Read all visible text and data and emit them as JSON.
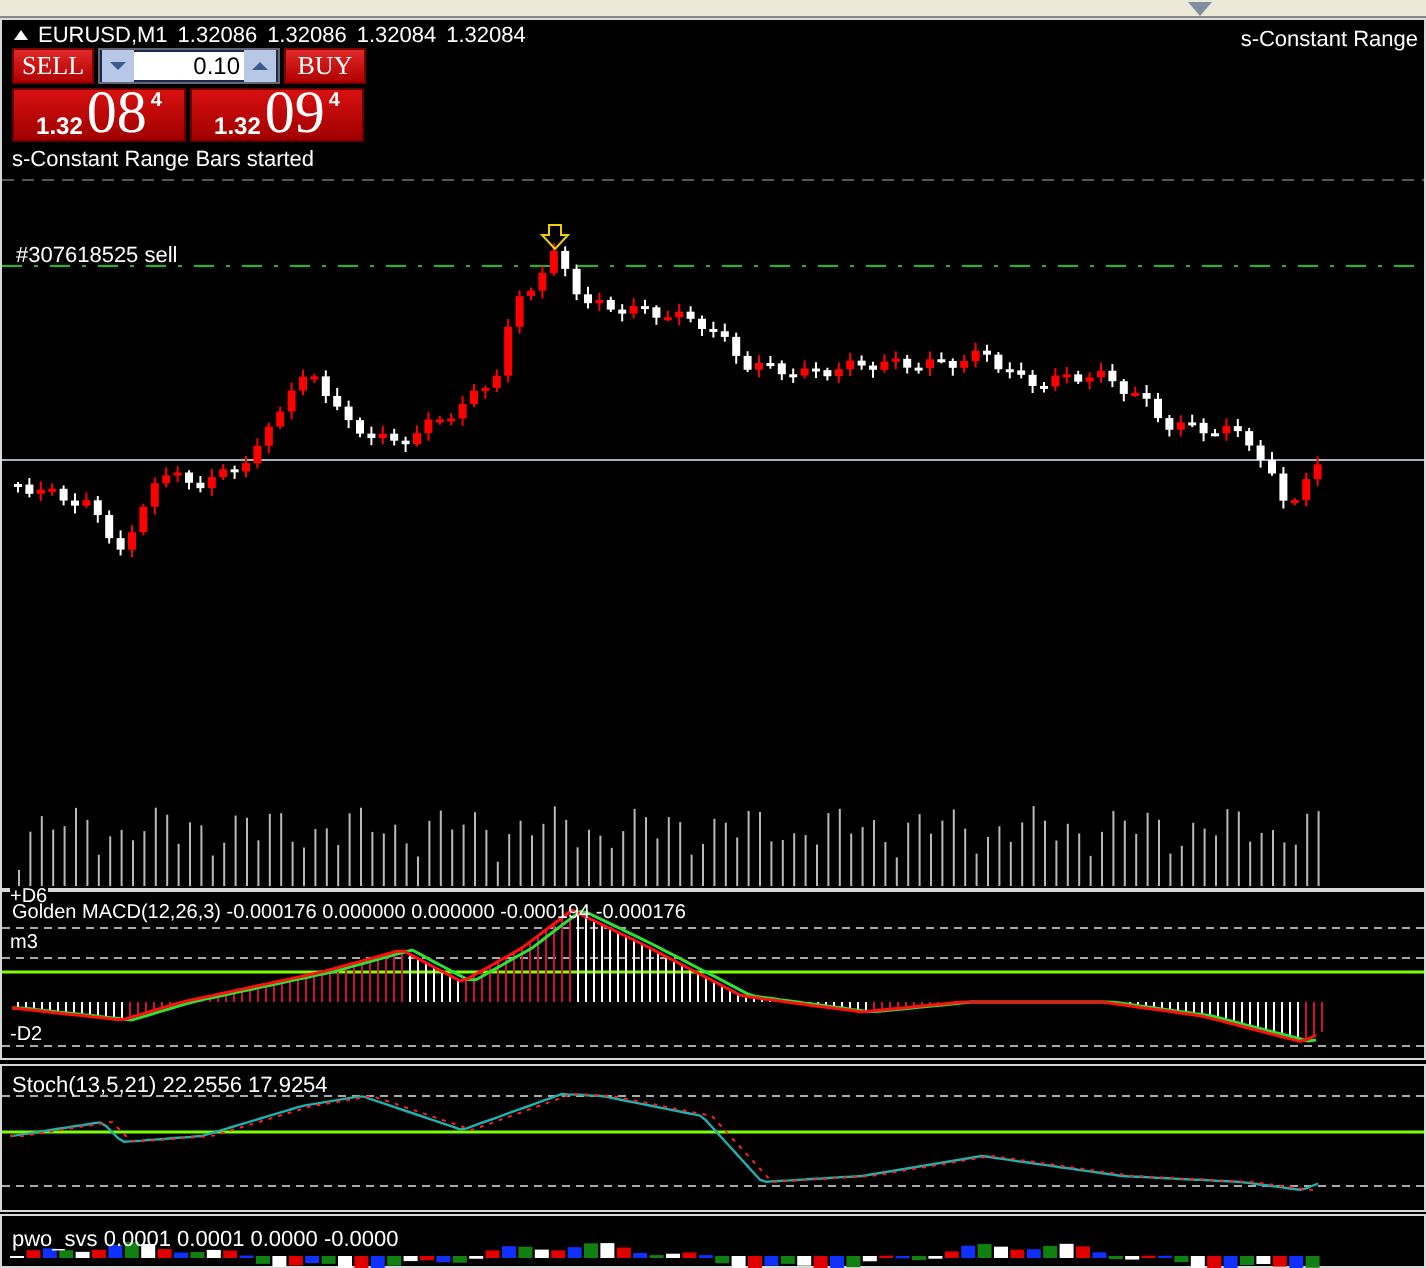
{
  "chart": {
    "symbol": "EURUSD,M1",
    "prices": [
      "1.32086",
      "1.32086",
      "1.32084",
      "1.32084"
    ],
    "indicator_label": "s-Constant Range",
    "status": "s-Constant Range Bars started",
    "order_label": "#307618525 sell"
  },
  "trade_panel": {
    "sell_button": "SELL",
    "buy_button": "BUY",
    "lot": "0.10",
    "sell_price": {
      "prefix": "1.32",
      "digits": "08",
      "last": "4"
    },
    "buy_price": {
      "prefix": "1.32",
      "digits": "09",
      "last": "4"
    }
  },
  "macd": {
    "title": "Golden MACD(12,26,3) -0.000176 0.000000 0.000000 -0.000194 -0.000176",
    "levels": [
      "+D6",
      "m3",
      "-D2"
    ]
  },
  "stoch": {
    "title": "Stoch(13,5,21) 22.2556 17.9254"
  },
  "pwo": {
    "title": "pwo_svs 0.0001 0.0001 0.0000 -0.0000"
  }
}
